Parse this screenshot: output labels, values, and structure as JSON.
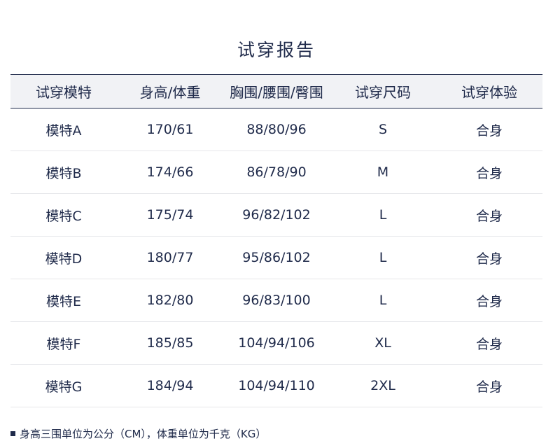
{
  "title": "试穿报告",
  "table": {
    "headers": [
      "试穿模特",
      "身高/体重",
      "胸围/腰围/臀围",
      "试穿尺码",
      "试穿体验"
    ],
    "rows": [
      [
        "模特A",
        "170/61",
        "88/80/96",
        "S",
        "合身"
      ],
      [
        "模特B",
        "174/66",
        "86/78/90",
        "M",
        "合身"
      ],
      [
        "模特C",
        "175/74",
        "96/82/102",
        "L",
        "合身"
      ],
      [
        "模特D",
        "180/77",
        "95/86/102",
        "L",
        "合身"
      ],
      [
        "模特E",
        "182/80",
        "96/83/100",
        "L",
        "合身"
      ],
      [
        "模特F",
        "185/85",
        "104/94/106",
        "XL",
        "合身"
      ],
      [
        "模特G",
        "184/94",
        "104/94/110",
        "2XL",
        "合身"
      ]
    ]
  },
  "note": "身高三围单位为公分（CM），体重单位为千克（KG）",
  "colors": {
    "text": "#1f2a4a",
    "header_bg": "#f1f2f5",
    "row_divider": "#e6e7ea"
  }
}
